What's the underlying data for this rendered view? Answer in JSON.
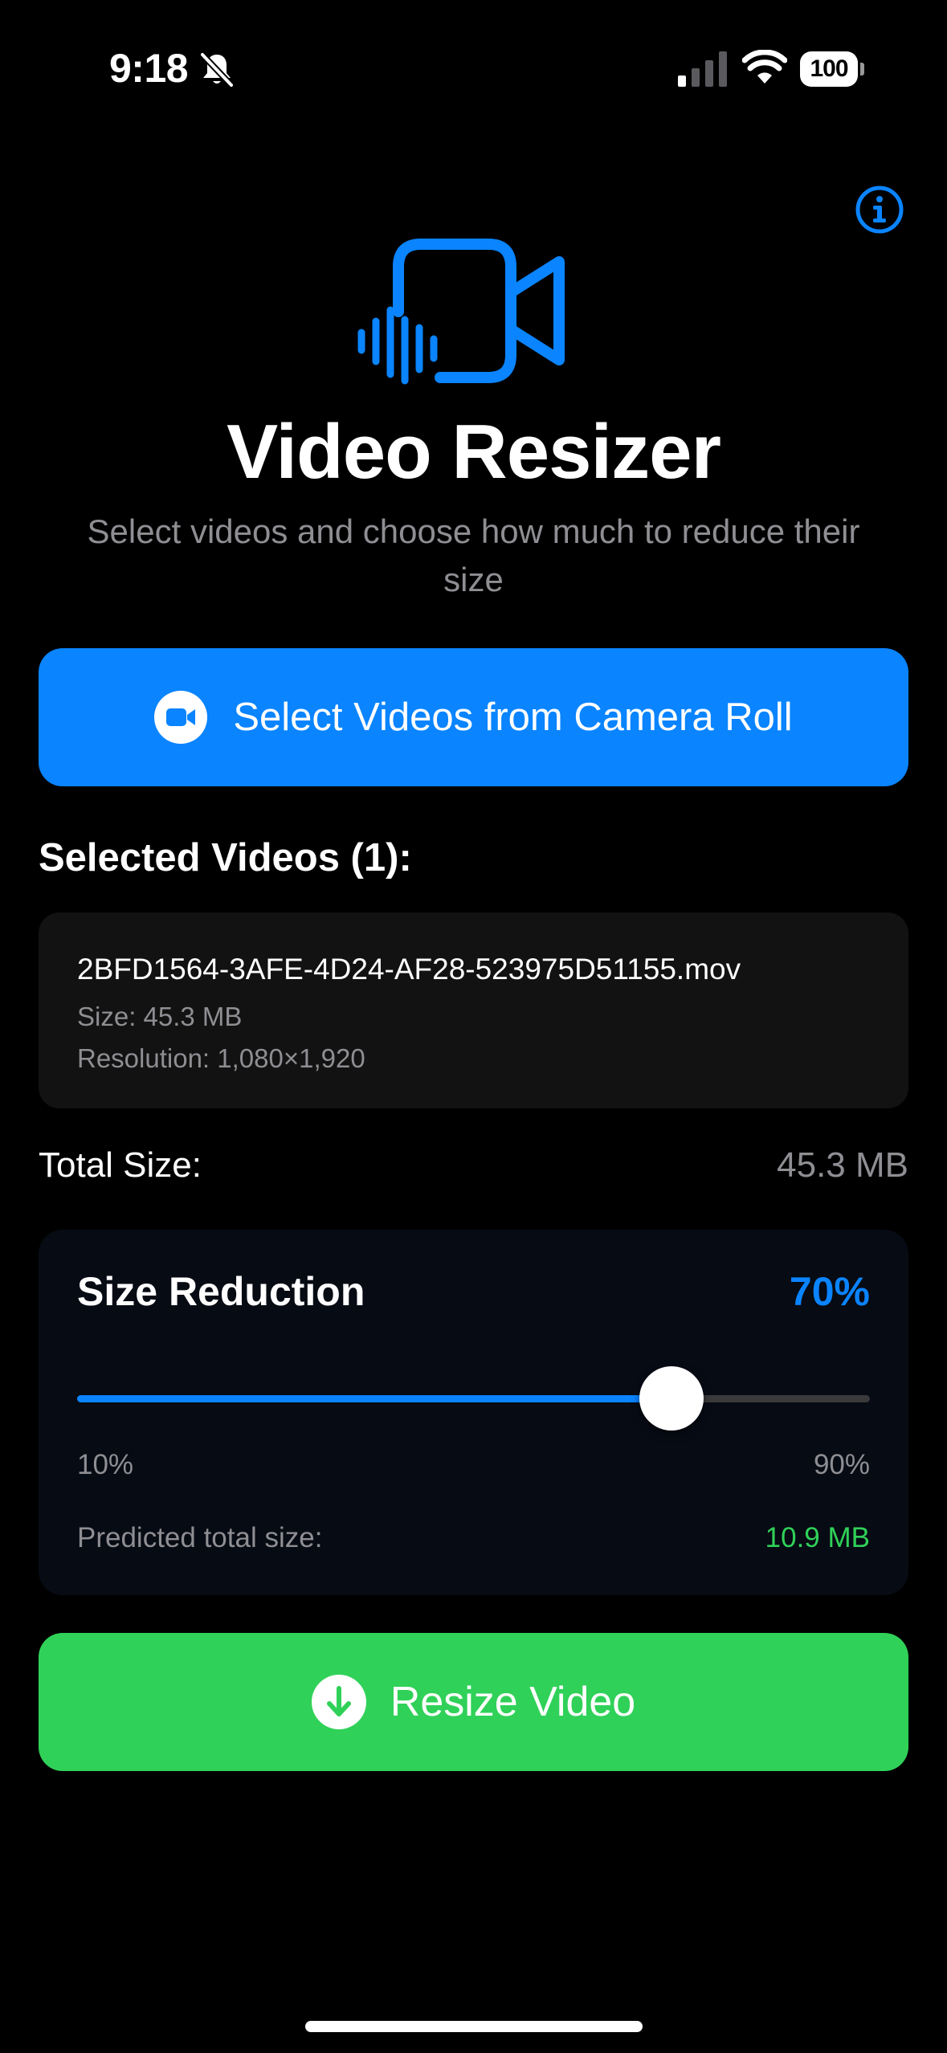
{
  "status_bar": {
    "time": "9:18",
    "battery": "100"
  },
  "header": {
    "title": "Video Resizer",
    "subtitle": "Select videos and choose how much to reduce their size"
  },
  "select_button": {
    "label": "Select Videos from Camera Roll"
  },
  "selected": {
    "heading": "Selected Videos (1):",
    "videos": [
      {
        "name": "2BFD1564-3AFE-4D24-AF28-523975D51155.mov",
        "size": "Size: 45.3 MB",
        "resolution": "Resolution: 1,080×1,920"
      }
    ]
  },
  "total": {
    "label": "Total Size:",
    "value": "45.3 MB"
  },
  "reduction": {
    "title": "Size Reduction",
    "value_label": "70%",
    "value": 70,
    "min": 10,
    "max": 90,
    "min_label": "10%",
    "max_label": "90%",
    "predicted_label": "Predicted total size:",
    "predicted_value": "10.9 MB"
  },
  "resize_button": {
    "label": "Resize Video"
  },
  "colors": {
    "accent_blue": "#0a84ff",
    "accent_green": "#30d158",
    "secondary_text": "#8e8e93",
    "background": "#000000"
  },
  "icons": {
    "hero": "video-camera-waveform-icon",
    "info": "info-circle-icon",
    "select": "video-camera-circle-icon",
    "resize": "download-circle-icon"
  }
}
